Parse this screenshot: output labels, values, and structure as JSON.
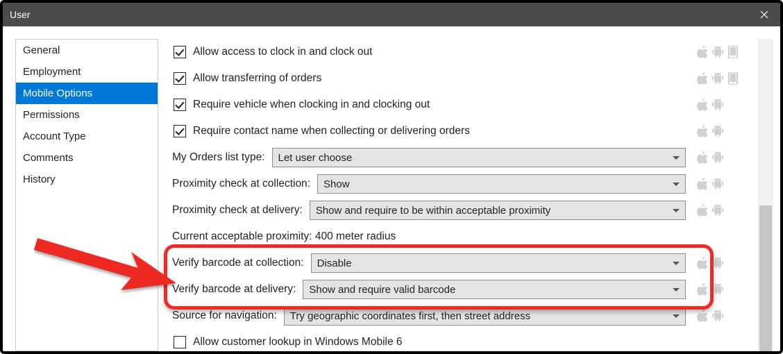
{
  "window": {
    "title": "User"
  },
  "sidebar": {
    "items": [
      {
        "label": "General"
      },
      {
        "label": "Employment"
      },
      {
        "label": "Mobile Options",
        "selected": true
      },
      {
        "label": "Permissions"
      },
      {
        "label": "Account Type"
      },
      {
        "label": "Comments"
      },
      {
        "label": "History"
      }
    ]
  },
  "options": {
    "allow_clock": {
      "label": "Allow access to clock in and clock out",
      "checked": true
    },
    "allow_transfer": {
      "label": "Allow transferring of orders",
      "checked": true
    },
    "require_vehicle": {
      "label": "Require vehicle when clocking in and clocking out",
      "checked": true
    },
    "require_contact": {
      "label": "Require contact name when collecting or delivering orders",
      "checked": true
    },
    "orders_list_type": {
      "label": "My Orders list type:",
      "value": "Let user choose"
    },
    "prox_collection": {
      "label": "Proximity check at collection:",
      "value": "Show"
    },
    "prox_delivery": {
      "label": "Proximity check at delivery:",
      "value": "Show and require to be within acceptable proximity"
    },
    "acceptable_prox": {
      "label": "Current acceptable proximity: 400 meter radius"
    },
    "barcode_collection": {
      "label": "Verify barcode at collection:",
      "value": "Disable"
    },
    "barcode_delivery": {
      "label": "Verify barcode at delivery:",
      "value": "Show and require valid barcode"
    },
    "nav_source": {
      "label": "Source for navigation:",
      "value": "Try geographic coordinates first, then street address"
    },
    "allow_lookup": {
      "label": "Allow customer lookup in Windows Mobile 6",
      "checked": false
    }
  }
}
